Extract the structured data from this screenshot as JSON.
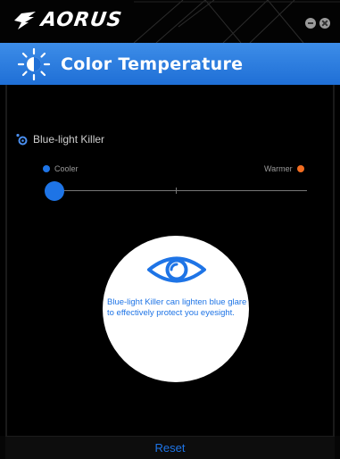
{
  "app": {
    "brand": "AORUS"
  },
  "window_controls": {
    "minimize_icon": "minus-circle-icon",
    "close_icon": "x-circle-icon"
  },
  "header": {
    "title": "Color Temperature",
    "icon": "sun-icon"
  },
  "feature": {
    "label": "Blue-light Killer",
    "icon": "blue-light-icon"
  },
  "slider": {
    "min_label": "Cooler",
    "max_label": "Warmer",
    "value": 0,
    "min": 0,
    "max": 100,
    "min_color": "#1e74e6",
    "max_color": "#f26d21"
  },
  "info": {
    "icon": "eye-icon",
    "message": "Blue-light Killer can lighten blue glare to effectively protect you eyesight."
  },
  "footer": {
    "reset_label": "Reset"
  },
  "colors": {
    "accent": "#1e74e6",
    "header_top": "#3d8de8",
    "header_bottom": "#1f6fd6",
    "background": "#000000"
  }
}
